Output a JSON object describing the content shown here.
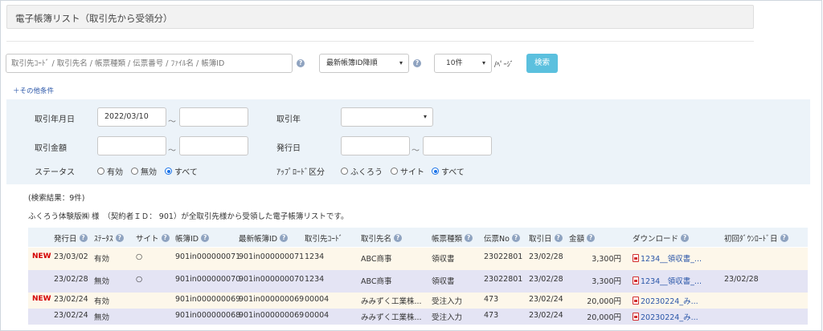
{
  "page": {
    "title": "電子帳簿リスト（取引先から受領分）"
  },
  "search": {
    "placeholder": "取引先ｺｰﾄﾞ / 取引先名 / 帳票種類 / 伝票番号 / ﾌｧｲﾙ名 / 帳簿ID",
    "sort_value": "最新帳簿ID降順",
    "per_page_value": "10件",
    "per_page_suffix": "/ﾍﾟｰｼﾞ",
    "search_button": "検索",
    "more_conditions": "＋その他条件"
  },
  "filters": {
    "trade_date_label": "取引年月日",
    "trade_date_from": "2022/03/10",
    "tilde": "～",
    "trade_year_label": "取引年",
    "amount_label": "取引金額",
    "issue_date_label": "発行日",
    "status_label": "ステータス",
    "status_options": [
      "有効",
      "無効",
      "すべて"
    ],
    "status_selected": "すべて",
    "upload_label": "ｱｯﾌﾟﾛｰﾄﾞ区分",
    "upload_options": [
      "ふくろう",
      "サイト",
      "すべて"
    ],
    "upload_selected": "すべて"
  },
  "results": {
    "count_text": "(検索結果：9件)",
    "description": "ふくろう体験版㈱ 様　（契約者ＩＤ： 901）が全取引先様から受領した電子帳簿リストです。"
  },
  "table": {
    "columns": [
      {
        "label": "発行日",
        "help": true
      },
      {
        "label": "ｽﾃｰﾀｽ",
        "help": true
      },
      {
        "label": "サイト",
        "help": true
      },
      {
        "label": "帳簿ID",
        "help": true
      },
      {
        "label": "最新帳簿ID",
        "help": true
      },
      {
        "label": "取引先ｺｰﾄﾞ",
        "help": false
      },
      {
        "label": "取引先名",
        "help": true
      },
      {
        "label": "帳票種類",
        "help": true
      },
      {
        "label": "伝票No",
        "help": true
      },
      {
        "label": "取引日",
        "help": true
      },
      {
        "label": "金額",
        "help": true
      },
      {
        "label": "ダウンロード",
        "help": true
      },
      {
        "label": "初回ﾀﾞｳﾝﾛｰﾄﾞ日",
        "help": true
      }
    ],
    "rows": [
      {
        "new": "NEW",
        "issue_date": "23/03/02",
        "status": "有効",
        "site": "○",
        "book_id": "901in000000071",
        "latest_id": "901in000000071",
        "partner_code": "1234",
        "partner_name": "ABC商事",
        "doc_type": "領収書",
        "slip_no": "23022801",
        "trade_date": "23/02/28",
        "amount": "3,300円",
        "download": "1234__領収書_...",
        "first_download": "",
        "bg": "#fdf7ea"
      },
      {
        "new": "",
        "issue_date": "23/02/28",
        "status": "無効",
        "site": "○",
        "book_id": "901in000000070",
        "latest_id": "901in000000070",
        "partner_code": "1234",
        "partner_name": "ABC商事",
        "doc_type": "領収書",
        "slip_no": "23022801",
        "trade_date": "23/02/28",
        "amount": "3,300円",
        "download": "1234__領収書_...",
        "first_download": "23/02/28",
        "bg": "#e4e4f4"
      },
      {
        "new": "NEW",
        "issue_date": "23/02/24",
        "status": "有効",
        "site": "",
        "book_id": "901in000000069",
        "latest_id": "901in000000069",
        "partner_code": "00004",
        "partner_name": "みみずく工業株...",
        "doc_type": "受注入力",
        "slip_no": "473",
        "trade_date": "23/02/24",
        "amount": "20,000円",
        "download": "20230224_み...",
        "first_download": "",
        "bg": "#fdf7ea"
      },
      {
        "new": "",
        "issue_date": "23/02/24",
        "status": "無効",
        "site": "",
        "book_id": "901in000000068",
        "latest_id": "901in000000069",
        "partner_code": "00004",
        "partner_name": "みみずく工業株...",
        "doc_type": "受注入力",
        "slip_no": "473",
        "trade_date": "23/02/24",
        "amount": "20,000円",
        "download": "20230224_み...",
        "first_download": "",
        "bg": "#e4e4f4"
      }
    ]
  },
  "colors": {
    "accent": "#5bc0de",
    "link": "#2a56a8",
    "new": "#d40000",
    "panel": "#ecf3f9"
  }
}
